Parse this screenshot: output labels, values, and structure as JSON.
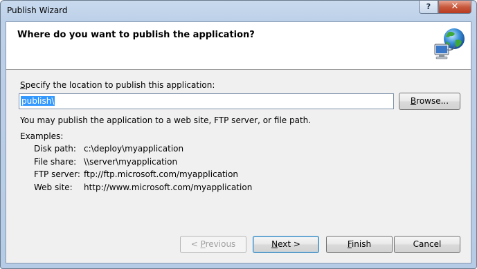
{
  "window": {
    "title": "Publish Wizard",
    "help_label": "?",
    "close_label": "✕"
  },
  "header": {
    "title": "Where do you want to publish the application?",
    "icon": "globe-network-icon"
  },
  "location": {
    "label_prefix": "S",
    "label_rest": "pecify the location to publish this application:",
    "value": "publish\\",
    "browse_prefix": "B",
    "browse_rest": "rowse..."
  },
  "info_text": "You may publish the application to a web site, FTP server, or file path.",
  "examples": {
    "label": "Examples:",
    "items": [
      {
        "key": "Disk path:",
        "value": "c:\\deploy\\myapplication"
      },
      {
        "key": "File share:",
        "value": "\\\\server\\myapplication"
      },
      {
        "key": "FTP server:",
        "value": "ftp://ftp.microsoft.com/myapplication"
      },
      {
        "key": "Web site:",
        "value": "http://www.microsoft.com/myapplication"
      }
    ]
  },
  "buttons": {
    "previous_prefix": "< ",
    "previous_key": "P",
    "previous_rest": "revious",
    "next_key": "N",
    "next_rest": "ext >",
    "finish_key": "F",
    "finish_rest": "inish",
    "cancel": "Cancel"
  }
}
